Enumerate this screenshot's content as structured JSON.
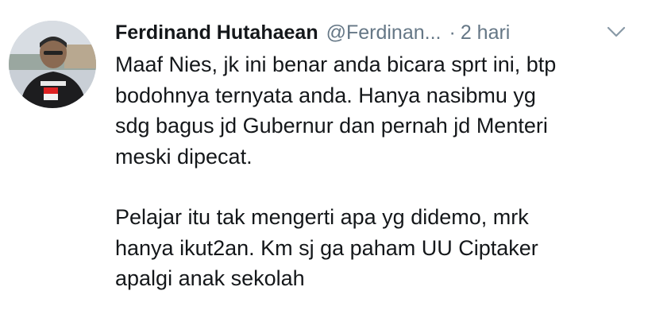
{
  "tweet": {
    "display_name": "Ferdinand Hutahaean",
    "handle": "@Ferdinan...",
    "separator": "·",
    "timestamp": "2 hari",
    "avatar_icon": "user-photo",
    "menu_icon": "chevron-down-icon",
    "accent_gray": "#657786",
    "text_color": "#14171a",
    "paragraphs": [
      {
        "lines": [
          "Maaf Nies, jk ini benar anda bicara sprt ini, btp",
          "bodohnya ternyata anda. Hanya nasibmu yg",
          "sdg bagus jd Gubernur dan pernah jd Menteri",
          "meski dipecat."
        ]
      },
      {
        "lines": [
          "Pelajar itu tak mengerti apa yg didemo, mrk",
          "hanya ikut2an. Km sj ga paham UU Ciptaker",
          "apalgi anak sekolah"
        ]
      }
    ]
  }
}
